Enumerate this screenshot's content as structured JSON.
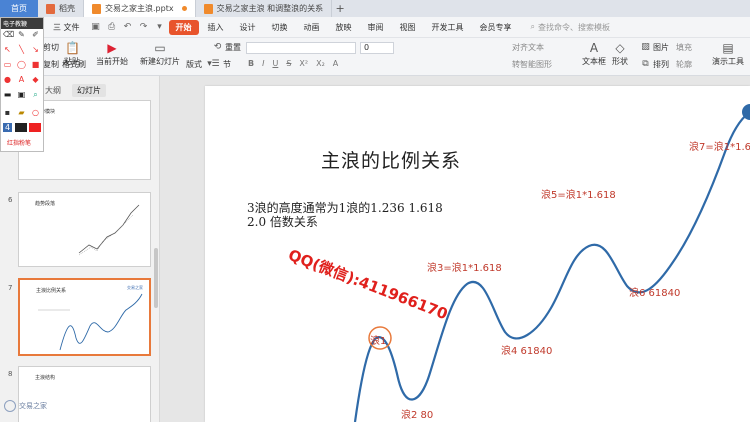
{
  "tabs": {
    "home": "首页",
    "shell": "稻壳",
    "doc1": "交易之家主浪.pptx",
    "doc2": "交易之家主浪 和调整浪的关系"
  },
  "menu": {
    "file": "三 文件",
    "items": [
      "开始",
      "插入",
      "设计",
      "切换",
      "动画",
      "放映",
      "审阅",
      "视图",
      "开发工具",
      "会员专享"
    ],
    "search": "查找命令、搜索模板"
  },
  "ribbon": {
    "cut": "剪切",
    "copy": "复制",
    "paste": "粘贴",
    "format_painter": "格式刷",
    "from_current": "当前开始",
    "new_slide": "新建幻灯片",
    "layout": "版式",
    "section": "节",
    "reset": "重置",
    "font_size": "0",
    "text_box": "文本框",
    "shape": "形状",
    "picture": "图片",
    "arrange": "排列",
    "fill": "填充",
    "outline": "轮廓",
    "present": "演示工具",
    "text_direction": "对齐文本",
    "convert_art": "转智能图形"
  },
  "pen_toolbar": {
    "title": "电子教鞭",
    "label": "红指粉笔"
  },
  "panel": {
    "tab_outline": "大纲",
    "tab_slides": "幻灯片",
    "thumb_titles": [
      "走势模块",
      "趋势段落",
      "主浪比例关系",
      "主浪结构"
    ],
    "thumb_numbers": [
      "6",
      "7",
      "8"
    ],
    "brand": "交易之家"
  },
  "slide": {
    "title": "主浪的比例关系",
    "body_line1": "3浪的高度通常为1浪的1.236  1.618",
    "body_line2": "2.0 倍数关系",
    "watermark": "QQ(微信):411966170",
    "labels": {
      "w1": "浪1",
      "w2": "浪2  80",
      "w3": "浪3=浪1*1.618",
      "w4": "浪4  61840",
      "w5": "浪5=浪1*1.618",
      "w6": "浪6  61840",
      "w7": "浪7=浪1*1.6"
    },
    "curve_color": "#2f6aa8",
    "label_color": "#c0392b",
    "highlight_color": "#e8793b"
  },
  "colors": {
    "accent": "#e8542c",
    "home_tab": "#4a83d4"
  }
}
